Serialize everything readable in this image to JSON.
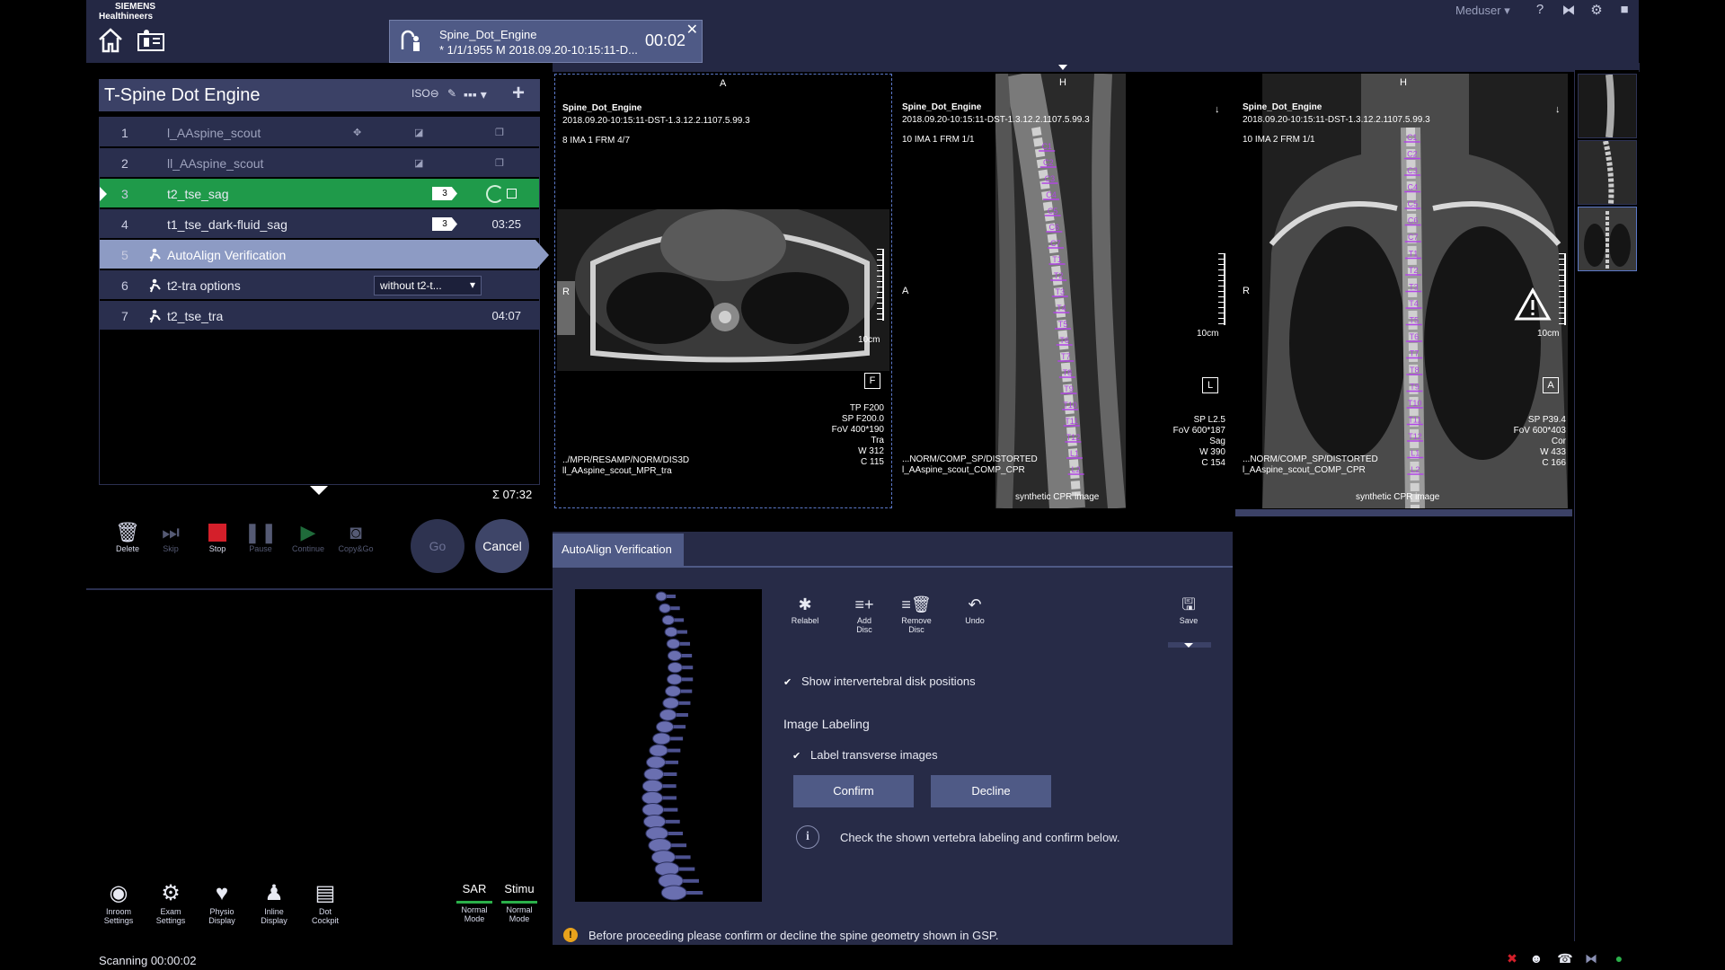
{
  "header": {
    "logo_line1": "SIEMENS",
    "logo_line2": "Healthineers",
    "user": "Meduser ▾",
    "icons": [
      "home-icon",
      "exam-icon",
      "help-icon",
      "bowtie-icon",
      "gear-icon",
      "camera-icon"
    ]
  },
  "patient": {
    "name": "Spine_Dot_Engine",
    "info": "* 1/1/1955 M 2018.09.20-10:15:11-D...",
    "elapsed": "00:02",
    "close": "✕"
  },
  "protocol": {
    "title": "T-Spine Dot Engine",
    "iso_label": "ISO⊖",
    "total_time": "Σ 07:32",
    "rows": [
      {
        "num": "1",
        "name": "l_AAspine_scout",
        "time": "",
        "state": "done"
      },
      {
        "num": "2",
        "name": "ll_AAspine_scout",
        "time": "",
        "state": "done"
      },
      {
        "num": "3",
        "name": "t2_tse_sag",
        "time": "",
        "state": "running",
        "badge": "3"
      },
      {
        "num": "4",
        "name": "t1_tse_dark-fluid_sag",
        "time": "03:25",
        "state": "queued",
        "badge": "3"
      },
      {
        "num": "5",
        "name": "AutoAlign Verification",
        "time": "",
        "state": "selected"
      },
      {
        "num": "6",
        "name": "t2-tra options",
        "time": "",
        "state": "queued",
        "option": "without t2-t..."
      },
      {
        "num": "7",
        "name": "t2_tse_tra",
        "time": "04:07",
        "state": "queued"
      }
    ]
  },
  "controls": {
    "delete": "Delete",
    "skip": "Skip",
    "stop": "Stop",
    "pause": "Pause",
    "continue": "Continue",
    "copy_go": "Copy&Go",
    "go": "Go",
    "cancel": "Cancel"
  },
  "bottom_tools": {
    "inroom": [
      "Inroom",
      "Settings"
    ],
    "exam": [
      "Exam",
      "Settings"
    ],
    "physio": [
      "Physio",
      "Display"
    ],
    "inline": [
      "Inline",
      "Display"
    ],
    "dot": [
      "Dot",
      "Cockpit"
    ],
    "sar_label": "SAR",
    "sar_mode": [
      "Normal",
      "Mode"
    ],
    "stimu_label": "Stimu",
    "stimu_mode": [
      "Normal",
      "Mode"
    ]
  },
  "status": {
    "scanning": "Scanning 00:00:02"
  },
  "viewers": [
    {
      "patient": "Spine_Dot_Engine",
      "study": "2018.09.20-10:15:11-DST-1.3.12.2.1107.5.99.3",
      "series": "8 IMA 1 FRM 4/7",
      "top_letter": "A",
      "left_letter": "R",
      "scale": "10cm",
      "orient_box": "F",
      "params": [
        "TP F200",
        "SP F200.0",
        "FoV 400*190",
        "Tra",
        "W        312",
        "C        115"
      ],
      "path": "../MPR/RESAMP/NORM/DIS3D",
      "series_name": "ll_AAspine_scout_MPR_tra",
      "footer": ""
    },
    {
      "patient": "Spine_Dot_Engine",
      "study": "2018.09.20-10:15:11-DST-1.3.12.2.1107.5.99.3",
      "series": "10 IMA 1 FRM 1/1",
      "top_letter": "H",
      "left_letter": "A",
      "scale": "10cm",
      "orient_box": "L",
      "params": [
        "SP L2.5",
        "FoV 600*187",
        "Sag",
        "W        390",
        "C        154"
      ],
      "path": "...NORM/COMP_SP/DISTORTED",
      "series_name": "l_AAspine_scout_COMP_CPR",
      "footer": "synthetic CPR image"
    },
    {
      "patient": "Spine_Dot_Engine",
      "study": "2018.09.20-10:15:11-DST-1.3.12.2.1107.5.99.3",
      "series": "10 IMA 2 FRM 1/1",
      "top_letter": "H",
      "left_letter": "R",
      "scale": "10cm",
      "orient_box": "A",
      "params": [
        "SP P39.4",
        "FoV 600*403",
        "Cor",
        "W        433",
        "C        166"
      ],
      "path": "...NORM/COMP_SP/DISTORTED",
      "series_name": "l_AAspine_scout_COMP_CPR",
      "footer": "synthetic CPR image"
    }
  ],
  "vertebra_labels": [
    "C1",
    "C2",
    "C3",
    "C4",
    "C5",
    "C6",
    "C7",
    "T1",
    "T2",
    "T3",
    "T4",
    "T5",
    "T6",
    "T7",
    "T8",
    "T9",
    "T10",
    "T11",
    "T12",
    "L1",
    "L2"
  ],
  "verification": {
    "tab": "AutoAlign Verification",
    "tools": {
      "relabel": "Relabel",
      "add_disc": [
        "Add",
        "Disc"
      ],
      "remove_disc": [
        "Remove",
        "Disc"
      ],
      "undo": "Undo",
      "save": "Save"
    },
    "show_disks": "Show intervertebral disk positions",
    "image_labeling_title": "Image Labeling",
    "label_transverse": "Label transverse images",
    "confirm": "Confirm",
    "decline": "Decline",
    "info": "Check the shown vertebra labeling and confirm below.",
    "warning": "Before proceeding please confirm or decline the spine geometry shown in GSP."
  },
  "colors": {
    "accent_green": "#1f9a4a",
    "selected_row": "#8d9bc4",
    "panel": "#272b47",
    "vertebra_label": "#b144e6",
    "warning": "#e8a21c"
  }
}
